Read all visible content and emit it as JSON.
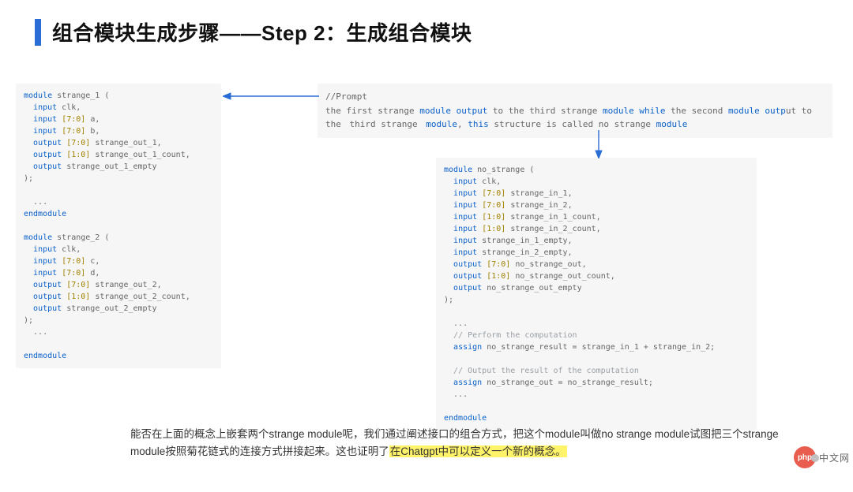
{
  "title": "组合模块生成步骤——Step 2：生成组合模块",
  "left_code": "module strange_1 (\n  input clk,\n  input [7:0] a,\n  input [7:0] b,\n  output [7:0] strange_out_1,\n  output [1:0] strange_out_1_count,\n  output strange_out_1_empty\n);\n\n  ...\nendmodule\n\nmodule strange_2 (\n  input clk,\n  input [7:0] c,\n  input [7:0] d,\n  output [7:0] strange_out_2,\n  output [1:0] strange_out_2_count,\n  output strange_out_2_empty\n);\n  ...\n\nendmodule",
  "prompt": {
    "label": "//Prompt",
    "body_parts": [
      "the first strange ",
      "module output",
      " to the third strange ",
      "module while",
      " the second ",
      "module outp",
      "ut",
      " to the  ",
      "third strange",
      "  ",
      "module",
      ", ",
      "this",
      " structure is called no strange ",
      "module"
    ]
  },
  "right_code": "module no_strange (\n  input clk,\n  input [7:0] strange_in_1,\n  input [7:0] strange_in_2,\n  input [1:0] strange_in_1_count,\n  input [1:0] strange_in_2_count,\n  input strange_in_1_empty,\n  input strange_in_2_empty,\n  output [7:0] no_strange_out,\n  output [1:0] no_strange_out_count,\n  output no_strange_out_empty\n);\n\n  ...\n  // Perform the computation\n  assign no_strange_result = strange_in_1 + strange_in_2;\n\n  // Output the result of the computation\n  assign no_strange_out = no_strange_result;\n  ...\n\nendmodule",
  "caption": {
    "seg1": "能否在上面的概念上嵌套两个strange module呢，我们通过阐述接口的组合方式，把这个module叫做no strange module试图把三个strange module按照菊花链式的连接方式拼接起来。这也证明了",
    "hl": "在Chatgpt中可以定义一个新的概念。",
    "seg2": ""
  },
  "watermark": {
    "logo": "php",
    "text": "中文网"
  }
}
